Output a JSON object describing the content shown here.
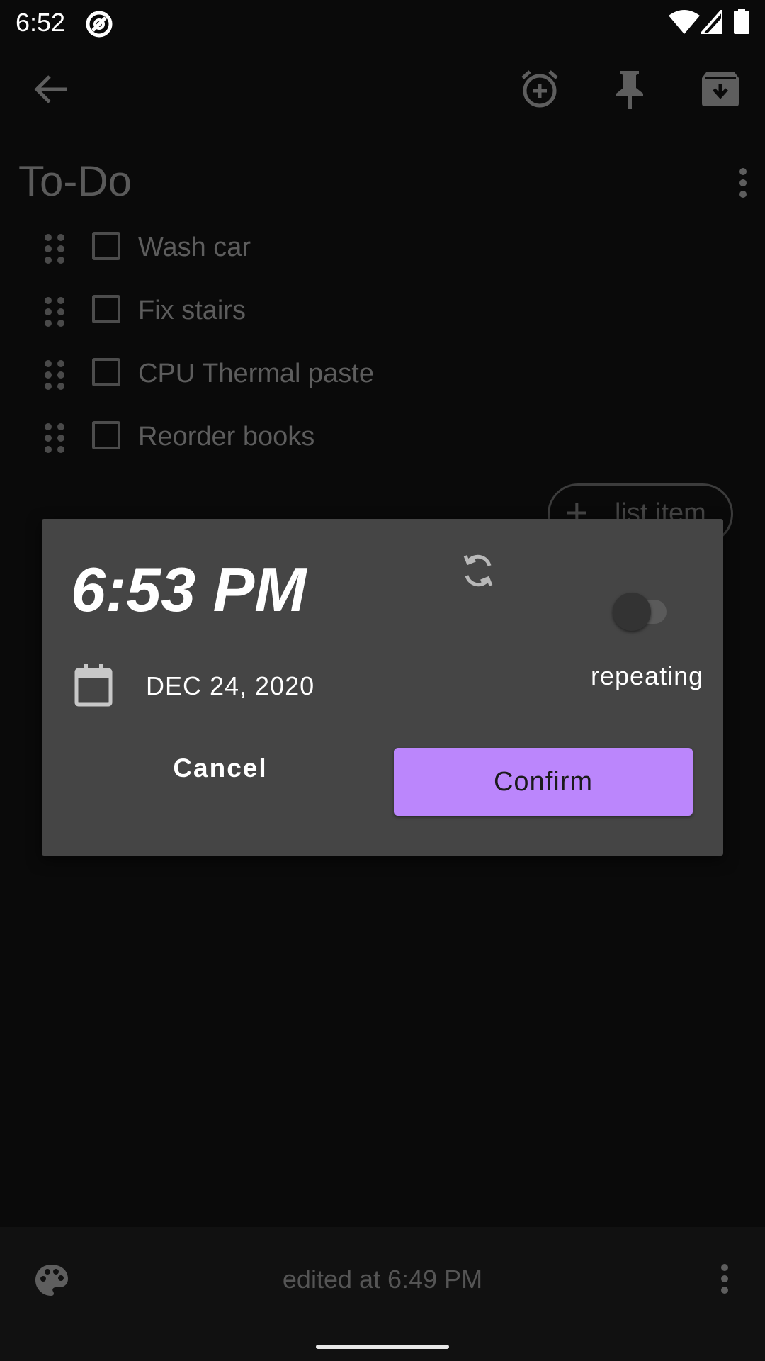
{
  "status_bar": {
    "time": "6:52"
  },
  "note": {
    "title": "To-Do",
    "items": [
      {
        "label": "Wash car"
      },
      {
        "label": "Fix stairs"
      },
      {
        "label": "CPU Thermal paste"
      },
      {
        "label": "Reorder books"
      }
    ],
    "add_item_label": "list item",
    "add_item_icon": "+"
  },
  "dialog": {
    "time": "6:53 PM",
    "date": "DEC 24, 2020",
    "repeating_label": "repeating",
    "repeating_enabled": false,
    "cancel_label": "Cancel",
    "confirm_label": "Confirm",
    "confirm_color": "#bb86fc"
  },
  "bottom_bar": {
    "edited_text": "edited at 6:49 PM"
  }
}
